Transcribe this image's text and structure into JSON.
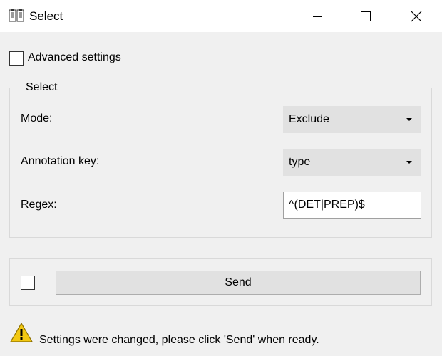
{
  "window": {
    "title": "Select",
    "app_icon": "document-copy-icon",
    "controls": [
      "minimize-icon",
      "maximize-icon",
      "close-icon"
    ]
  },
  "advanced_settings": {
    "label": "Advanced settings",
    "checked": false
  },
  "select_group": {
    "title": "Select",
    "mode": {
      "label": "Mode:",
      "value": "Exclude"
    },
    "annotation_key": {
      "label": "Annotation key:",
      "value": "type"
    },
    "regex": {
      "label": "Regex:",
      "value": "^(DET|PREP)$"
    }
  },
  "send_section": {
    "auto_send_checked": false,
    "send_label": "Send"
  },
  "status": {
    "icon": "warning-icon",
    "message": "Settings were changed, please click 'Send' when ready."
  },
  "colors": {
    "background": "#f0f0f0",
    "titlebar": "#ffffff",
    "control": "#e1e1e1",
    "warning": "#f2c811"
  }
}
